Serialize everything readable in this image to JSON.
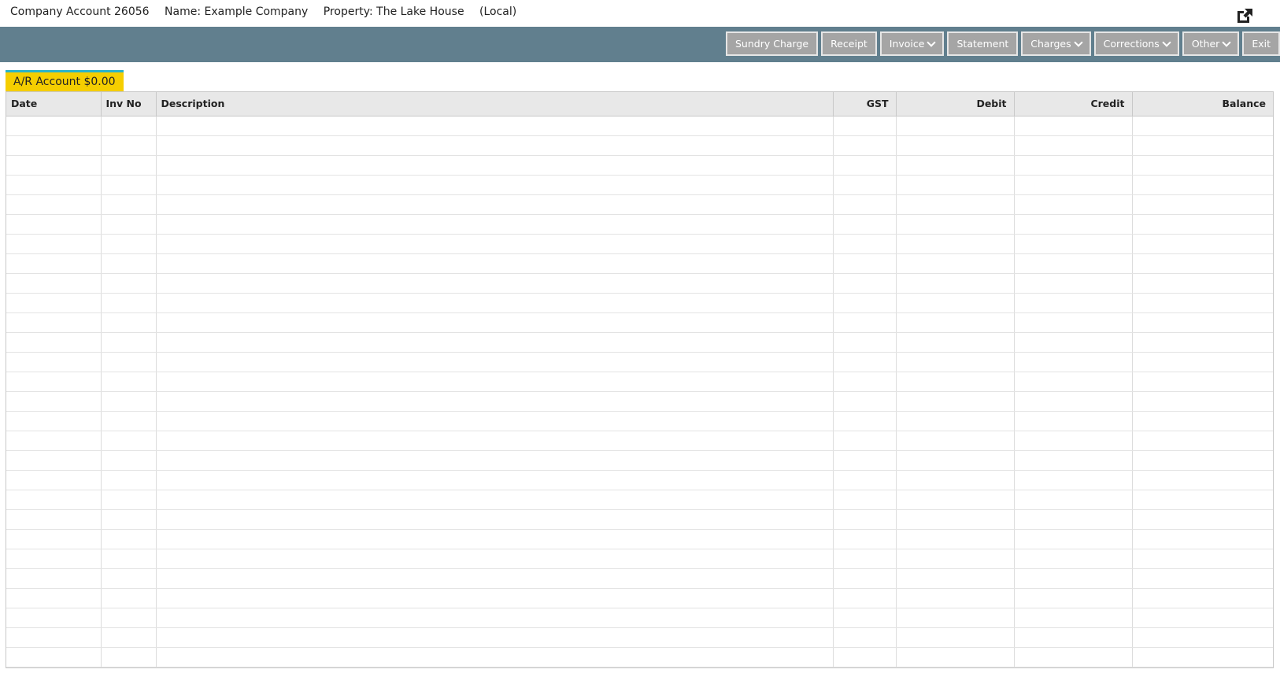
{
  "header": {
    "account": "Company Account 26056",
    "name": "Name: Example Company",
    "property": "Property: The Lake House",
    "location": "(Local)",
    "popout_icon": "external-link-icon"
  },
  "toolbar": {
    "buttons": [
      {
        "label": "Sundry Charge",
        "dropdown": false
      },
      {
        "label": "Receipt",
        "dropdown": false
      },
      {
        "label": "Invoice",
        "dropdown": true
      },
      {
        "label": "Statement",
        "dropdown": false
      },
      {
        "label": "Charges",
        "dropdown": true
      },
      {
        "label": "Corrections",
        "dropdown": true
      },
      {
        "label": "Other",
        "dropdown": true
      },
      {
        "label": "Exit",
        "dropdown": false
      }
    ]
  },
  "tab": {
    "label": "A/R Account $0.00"
  },
  "table": {
    "columns": [
      "Date",
      "Inv No",
      "Description",
      "GST",
      "Debit",
      "Credit",
      "Balance"
    ],
    "rows": []
  },
  "colors": {
    "toolbar_bg": "#617f8e",
    "button_bg": "#a5a5a5",
    "tab_bg": "#f5ce00",
    "tab_accent": "#2bb3c9"
  }
}
